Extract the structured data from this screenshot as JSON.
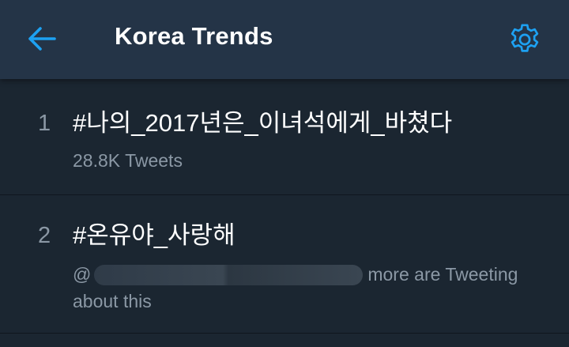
{
  "header": {
    "title": "Korea Trends",
    "back_icon": "arrow-left-icon",
    "settings_icon": "gear-icon",
    "accent_color": "#1da1f2"
  },
  "trends": [
    {
      "rank": "1",
      "hashtag": "#나의_2017년은_이녀석에게_바쳤다",
      "meta": "28.8K Tweets"
    },
    {
      "rank": "2",
      "hashtag": "#온유야_사랑해",
      "meta_prefix": "@",
      "meta_suffix": "more are Tweeting about this"
    }
  ]
}
